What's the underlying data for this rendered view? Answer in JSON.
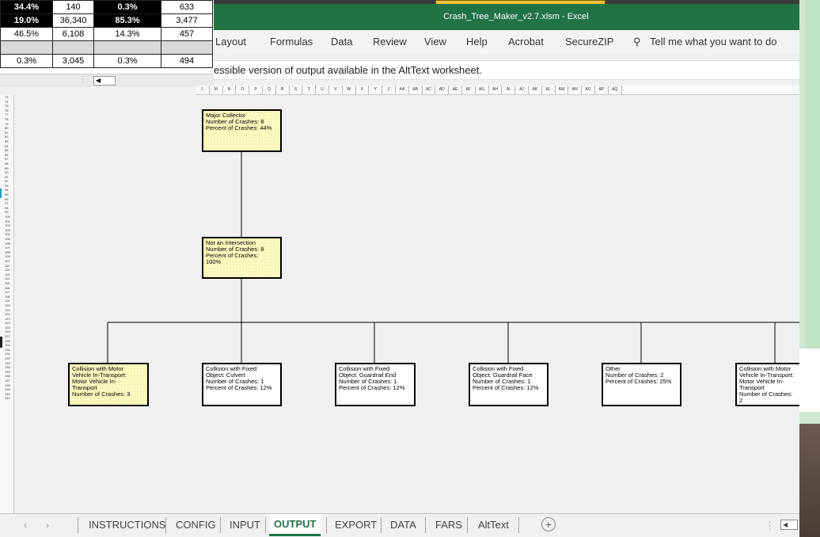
{
  "background_window": {
    "rows": [
      [
        "34.4%",
        "140",
        "0.3%",
        "633"
      ],
      [
        "19.0%",
        "36,340",
        "85.3%",
        "3,477"
      ],
      [
        "46.5%",
        "6,108",
        "14.3%",
        "457"
      ],
      [
        "",
        "",
        "",
        ""
      ],
      [
        "0.3%",
        "3,045",
        "0.3%",
        "494"
      ]
    ],
    "scroll_left_arrow": "◀"
  },
  "titlebar": {
    "title": "Crash_Tree_Maker_v2.7.xlsm  -  Excel"
  },
  "ribbon": {
    "tabs": [
      "Layout",
      "Formulas",
      "Data",
      "Review",
      "View",
      "Help",
      "Acrobat",
      "SecureZIP"
    ],
    "search_placeholder": "Tell me what you want to do"
  },
  "infobar": {
    "message": "essible version of output available in the AltText worksheet."
  },
  "column_headers": [
    "L",
    "M",
    "N",
    "O",
    "P",
    "Q",
    "R",
    "S",
    "T",
    "U",
    "V",
    "W",
    "X",
    "Y",
    "Z",
    "AA",
    "AB",
    "AC",
    "AD",
    "AE",
    "AF",
    "AG",
    "AH",
    "AI",
    "AJ",
    "AK",
    "AL",
    "AM",
    "AN",
    "AO",
    "AP",
    "AQ"
  ],
  "row_headers": [
    "73",
    "74",
    "75",
    "76",
    "77",
    "78",
    "79",
    "80",
    "81",
    "82",
    "83",
    "84",
    "85",
    "86",
    "87",
    "88",
    "89",
    "90",
    "91",
    "92",
    "93",
    "94",
    "95",
    "96",
    "97",
    "98",
    "99",
    "100",
    "101",
    "102",
    "103",
    "104",
    "105",
    "106",
    "107",
    "108",
    "109",
    "110",
    "111",
    "112",
    "113",
    "114",
    "115",
    "116",
    "117",
    "118",
    "119",
    "120",
    "121",
    "122",
    "123",
    "124",
    "125",
    "126",
    "127",
    "128",
    "129",
    "130",
    "131",
    "132",
    "133",
    "134",
    "135",
    "136",
    "137",
    "138",
    "139",
    "140",
    "141"
  ],
  "tree": {
    "root": {
      "lines": [
        "Major Collector",
        "Number of Crashes: 8",
        "Percent of Crashes: 44%"
      ]
    },
    "level2": {
      "lines": [
        "Not an Intersection",
        "Number of Crashes: 8",
        "Percent of Crashes:",
        "100%"
      ]
    },
    "leaves": [
      {
        "lines": [
          "Collision with Motor",
          "Vehicle In-Transport:",
          "Motor Vehicle In-",
          "Transport",
          "Number of Crashes: 3"
        ]
      },
      {
        "lines": [
          "Collision with Fixed",
          "Object: Culvert",
          "Number of Crashes: 1",
          "Percent of Crashes: 12%"
        ]
      },
      {
        "lines": [
          "Collision with Fixed",
          "Object: Guardrail End",
          "Number of Crashes: 1",
          "Percent of Crashes: 12%"
        ]
      },
      {
        "lines": [
          "Collision with Fixed",
          "Object: Guardrail Face",
          "Number of Crashes: 1",
          "Percent of Crashes: 12%"
        ]
      },
      {
        "lines": [
          "Other",
          "Number of Crashes: 2",
          "Percent of Crashes: 25%"
        ]
      },
      {
        "lines": [
          "Collision with Motor",
          "Vehicle In-Transport:",
          "Motor Vehicle In-",
          "Transport",
          "Number of Crashes: 2"
        ]
      }
    ]
  },
  "sheet_tabs": {
    "tabs": [
      "INSTRUCTIONS",
      "CONFIG",
      "INPUT",
      "OUTPUT",
      "EXPORT",
      "DATA",
      "FARS",
      "AltText"
    ],
    "active": "OUTPUT",
    "add_symbol": "+",
    "nav_prev": "‹",
    "nav_next": "›",
    "right_dots": "⋮",
    "right_arrow": "◀"
  },
  "colors": {
    "excel_green": "#217346",
    "node_highlight": "#fffcc0",
    "grid_bg": "#f0f0f0"
  }
}
